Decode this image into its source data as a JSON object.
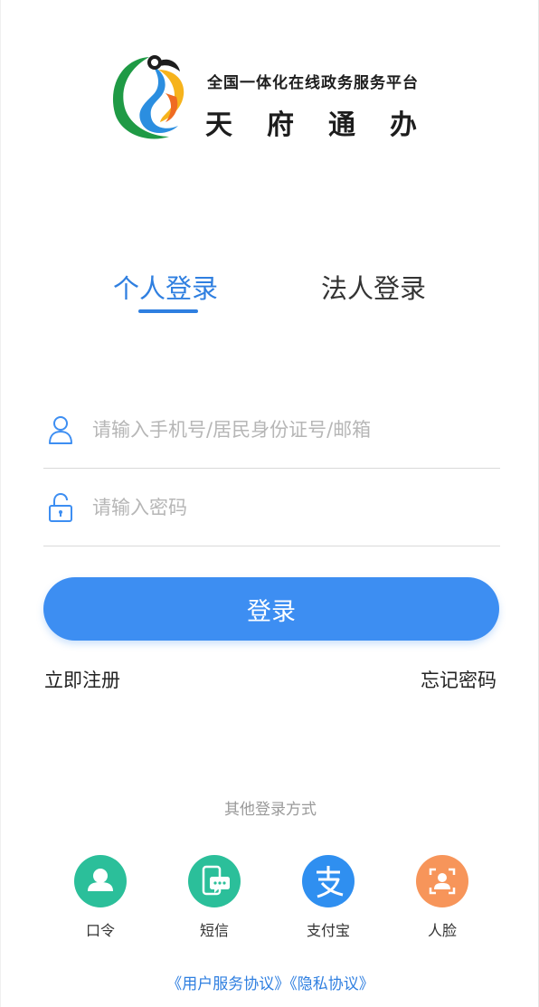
{
  "brand": {
    "slogan": "全国一体化在线政务服务平台",
    "name": "天府通办"
  },
  "tabs": [
    {
      "label": "个人登录",
      "active": true
    },
    {
      "label": "法人登录",
      "active": false
    }
  ],
  "form": {
    "account_placeholder": "请输入手机号/居民身份证号/邮箱",
    "account_value": "",
    "password_placeholder": "请输入密码",
    "password_value": ""
  },
  "login_button": "登录",
  "register_link": "立即注册",
  "forgot_link": "忘记密码",
  "other_methods_title": "其他登录方式",
  "methods": [
    {
      "label": "口令",
      "icon": "user-icon",
      "color": "#2bbf9a"
    },
    {
      "label": "短信",
      "icon": "sms-icon",
      "color": "#2bbf9a"
    },
    {
      "label": "支付宝",
      "icon": "alipay-icon",
      "color": "#2f8ff0"
    },
    {
      "label": "人脸",
      "icon": "face-icon",
      "color": "#f7955a"
    }
  ],
  "agreements": {
    "user_service": "《用户服务协议》",
    "privacy": "《隐私协议》"
  },
  "colors": {
    "accent": "#2f7fe0",
    "button": "#3d8ef2"
  }
}
